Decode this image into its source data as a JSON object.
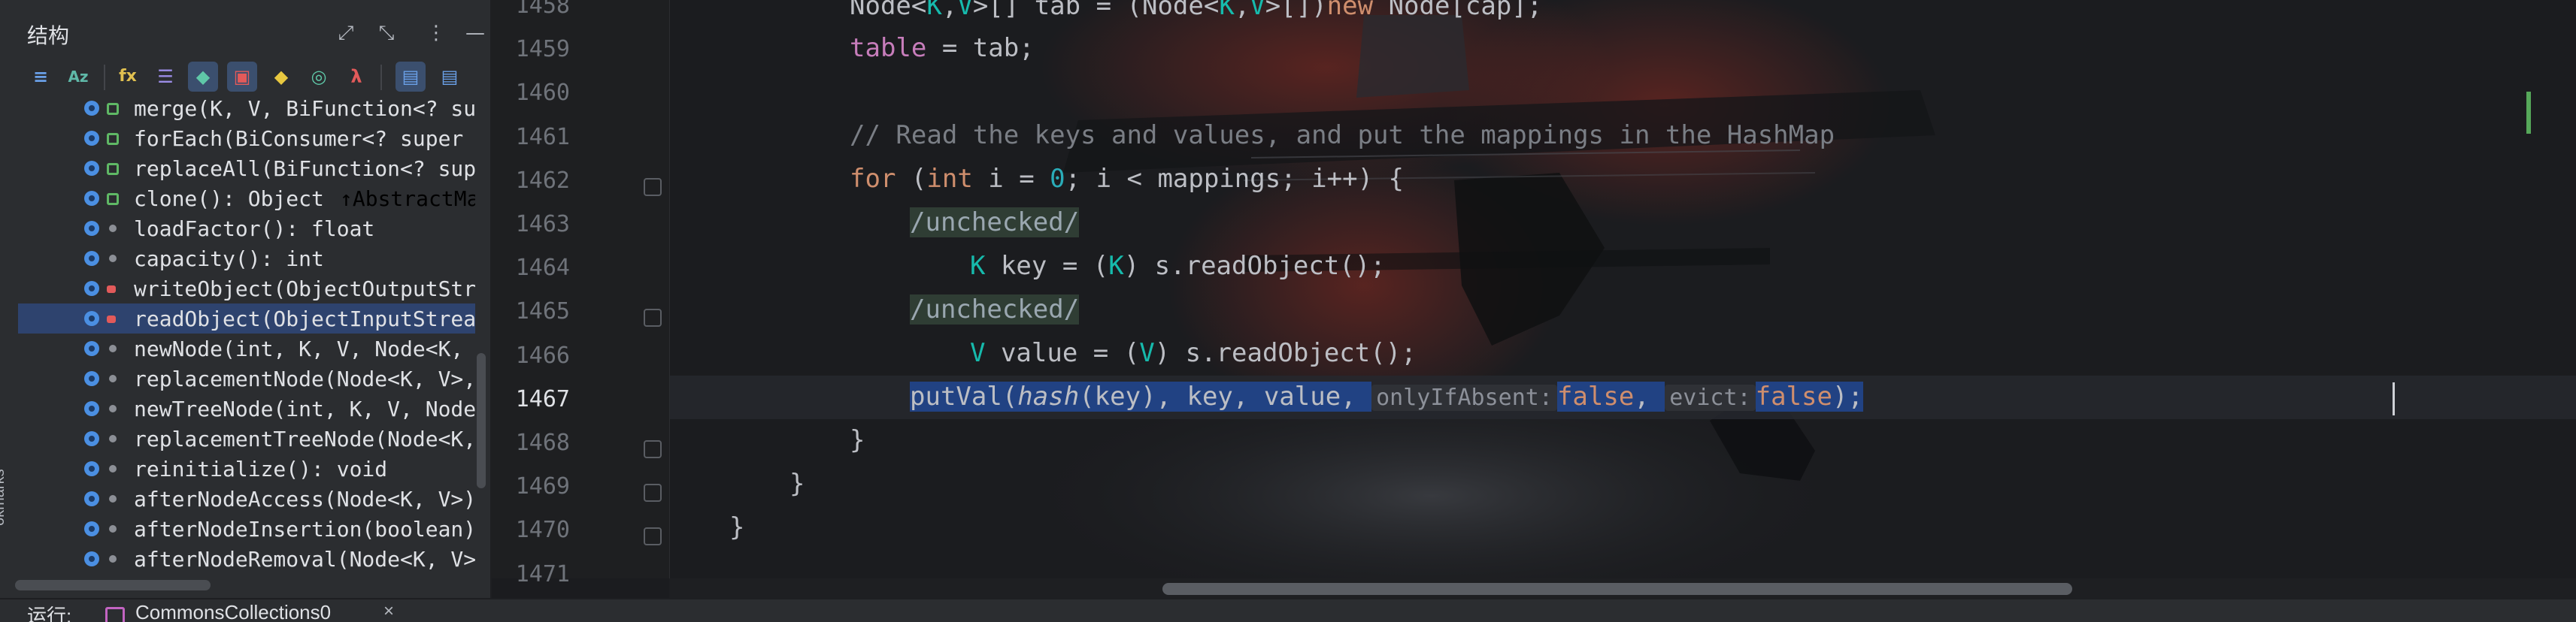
{
  "structure": {
    "title": "结构",
    "header_icons": [
      "expand-icon",
      "collapse-icon",
      "more-icon",
      "minimize-icon"
    ],
    "toolbar_icons": [
      "sort-visibility-icon",
      "sort-alpha-icon",
      "show-fields-icon",
      "show-properties-icon",
      "show-tags-icon",
      "show-non-public-icon",
      "show-inherited-icon",
      "show-anonymous-icon",
      "show-lambdas-icon",
      "navigate-from-source-icon",
      "navigate-to-source-icon"
    ],
    "items": [
      {
        "label": "merge(K, V, BiFunction<? su",
        "access": "public",
        "hint": ""
      },
      {
        "label": "forEach(BiConsumer<? super",
        "access": "public",
        "hint": ""
      },
      {
        "label": "replaceAll(BiFunction<? sup",
        "access": "public",
        "hint": ""
      },
      {
        "label": "clone(): Object",
        "access": "public",
        "hint": "↑AbstractMa"
      },
      {
        "label": "loadFactor(): float",
        "access": "package",
        "hint": ""
      },
      {
        "label": "capacity(): int",
        "access": "package",
        "hint": ""
      },
      {
        "label": "writeObject(ObjectOutputStr",
        "access": "private",
        "hint": ""
      },
      {
        "label": "readObject(ObjectInputStrea",
        "access": "private",
        "hint": "",
        "selected": true
      },
      {
        "label": "newNode(int, K, V, Node<K,",
        "access": "package",
        "hint": ""
      },
      {
        "label": "replacementNode(Node<K, V>,",
        "access": "package",
        "hint": ""
      },
      {
        "label": "newTreeNode(int, K, V, Node",
        "access": "package",
        "hint": ""
      },
      {
        "label": "replacementTreeNode(Node<K,",
        "access": "package",
        "hint": ""
      },
      {
        "label": "reinitialize(): void",
        "access": "package",
        "hint": ""
      },
      {
        "label": "afterNodeAccess(Node<K, V>)",
        "access": "package",
        "hint": ""
      },
      {
        "label": "afterNodeInsertion(boolean)",
        "access": "package",
        "hint": ""
      },
      {
        "label": "afterNodeRemoval(Node<K, V>",
        "access": "package",
        "hint": ""
      }
    ],
    "side_label": "okmarks"
  },
  "editor": {
    "line_numbers": [
      "1458",
      "1459",
      "1460",
      "1461",
      "1462",
      "1463",
      "1464",
      "1465",
      "1466",
      "1467",
      "1468",
      "1469",
      "1470",
      "1471"
    ],
    "current_line": "1467",
    "code": {
      "l1458_a": "Node<",
      "l1458_k": "K",
      "l1458_b": ",",
      "l1458_v": "V",
      "l1458_c": ">[] tab = (Node<",
      "l1458_k2": "K",
      "l1458_d": ",",
      "l1458_v2": "V",
      "l1458_e": ">[])",
      "l1458_new": "new",
      "l1458_f": " Node[cap];",
      "l1459_field": "table",
      "l1459_rest": " = tab;",
      "l1461_comment": "// Read the keys and values, and put the mappings in the HashMap",
      "l1462_for": "for",
      "l1462_a": " (",
      "l1462_int": "int",
      "l1462_b": " i = ",
      "l1462_zero": "0",
      "l1462_c": "; i < mappings; i++) {",
      "l1463_inj": "/unchecked/",
      "l1464_k": "K",
      "l1464_a": " key = (",
      "l1464_k2": "K",
      "l1464_b": ") s.readObject();",
      "l1465_inj": "/unchecked/",
      "l1466_v": "V",
      "l1466_a": " value = (",
      "l1466_v2": "V",
      "l1466_b": ") s.readObject();",
      "l1467_a": "putVal(",
      "l1467_hash": "hash",
      "l1467_b": "(key), key, value, ",
      "l1467_hint1": "onlyIfAbsent:",
      "l1467_false1": "false",
      "l1467_c": ", ",
      "l1467_hint2": "evict:",
      "l1467_false2": "false",
      "l1467_d": ");",
      "l1468": "}",
      "l1469": "}",
      "l1470": "}"
    }
  },
  "runbar": {
    "label": "运行:",
    "tab_name": "CommonsCollections0",
    "close": "×"
  },
  "colors": {
    "keyword": "#cf8e6d",
    "field": "#c77dbb",
    "comment": "#7a7e85",
    "number": "#2aacb8",
    "type_param": "#16baac",
    "selection": "#214283"
  }
}
